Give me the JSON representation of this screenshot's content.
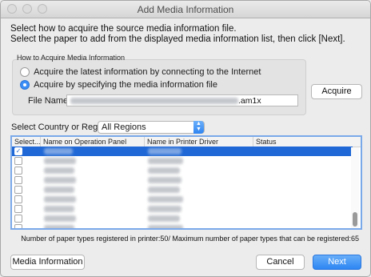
{
  "window": {
    "title": "Add Media Information"
  },
  "instructions": {
    "line1": "Select how to acquire the source media information file.",
    "line2": "Select the paper to add from the displayed media information list, then click [Next]."
  },
  "acquire_group": {
    "label": "How to Acquire Media Information",
    "option_internet": "Acquire the latest information by connecting to the Internet",
    "option_file": "Acquire by specifying the media information file",
    "selected": "option_file",
    "file_name_label": "File Name:",
    "file_name_value": ".am1x",
    "acquire_button": "Acquire"
  },
  "region": {
    "label": "Select Country or Region",
    "selected": "All Regions"
  },
  "table": {
    "columns": [
      "Select...",
      "Name on Operation Panel",
      "Name in Printer Driver",
      "Status"
    ],
    "rows": [
      {
        "checked": true,
        "selected": true
      },
      {
        "checked": false,
        "selected": false
      },
      {
        "checked": false,
        "selected": false
      },
      {
        "checked": false,
        "selected": false
      },
      {
        "checked": false,
        "selected": false
      },
      {
        "checked": false,
        "selected": false
      },
      {
        "checked": false,
        "selected": false
      },
      {
        "checked": false,
        "selected": false
      },
      {
        "checked": false,
        "selected": false
      }
    ],
    "check_glyph": "✓"
  },
  "status": {
    "count_text": "Number of paper types registered in printer:50/ Maximum number of paper types that can be registered:65"
  },
  "footer": {
    "media_info_button": "Media Information",
    "cancel_button": "Cancel",
    "next_button": "Next"
  },
  "colors": {
    "accent": "#2d86f3",
    "selection": "#1f68d6"
  }
}
